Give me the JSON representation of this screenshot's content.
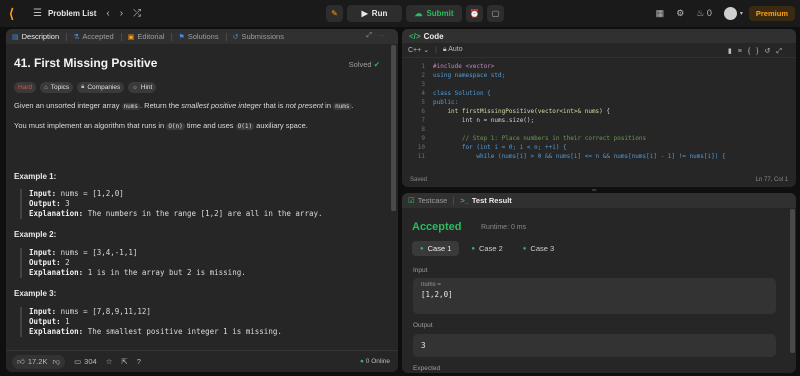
{
  "nav": {
    "title": "Problem List",
    "run_label": "Run",
    "submit_label": "Submit",
    "streak_count": "0",
    "premium_label": "Premium"
  },
  "left": {
    "tabs": [
      "Description",
      "Accepted",
      "Editorial",
      "Solutions",
      "Submissions"
    ],
    "problem_title": "41. First Missing Positive",
    "status": "Solved",
    "tags": [
      "Hard",
      "Topics",
      "Companies",
      "Hint"
    ],
    "desc1": {
      "a": "Given an unsorted integer array ",
      "code1": "nums",
      "b": ". Return the ",
      "em1": "smallest positive integer",
      "c": " that is ",
      "em2": "not present",
      "d": " in ",
      "code2": "nums",
      "e": "."
    },
    "desc2": {
      "a": "You must implement an algorithm that runs in ",
      "code1": "O(n)",
      "b": " time and uses ",
      "code2": "O(1)",
      "c": " auxiliary space."
    },
    "examples": [
      {
        "head": "Example 1:",
        "input": "nums = [1,2,0]",
        "output": "3",
        "explanation": "The numbers in the range [1,2] are all in the array."
      },
      {
        "head": "Example 2:",
        "input": "nums = [3,4,-1,1]",
        "output": "2",
        "explanation": "1 is in the array but 2 is missing."
      },
      {
        "head": "Example 3:",
        "input": "nums = [7,8,9,11,12]",
        "output": "1",
        "explanation": "The smallest positive integer 1 is missing."
      }
    ],
    "labels": {
      "input": "Input:",
      "output": "Output:",
      "explanation": "Explanation:"
    },
    "footer": {
      "likes": "17.2K",
      "comments": "304",
      "online": "0 Online"
    }
  },
  "code": {
    "title": "Code",
    "language": "C++",
    "mode": "Auto",
    "lines": [
      "#include <vector>",
      "using namespace std;",
      "",
      "class Solution {",
      "public:",
      "    int firstMissingPositive(vector<int>& nums) {",
      "        int n = nums.size();",
      "",
      "        // Step 1: Place numbers in their correct positions",
      "        for (int i = 0; i < n; ++i) {",
      "            while (nums[i] > 0 && nums[i] <= n && nums[nums[i] - 1] != nums[i]) {"
    ],
    "saved": "Saved",
    "cursor": "Ln 77, Col 1"
  },
  "test": {
    "tabs": [
      "Testcase",
      "Test Result"
    ],
    "result": "Accepted",
    "runtime": "Runtime: 0 ms",
    "cases": [
      "Case 1",
      "Case 2",
      "Case 3"
    ],
    "input_label": "Input",
    "var_name": "nums =",
    "var_value": "[1,2,0]",
    "output_label": "Output",
    "output_value": "3",
    "expected_label": "Expected"
  }
}
